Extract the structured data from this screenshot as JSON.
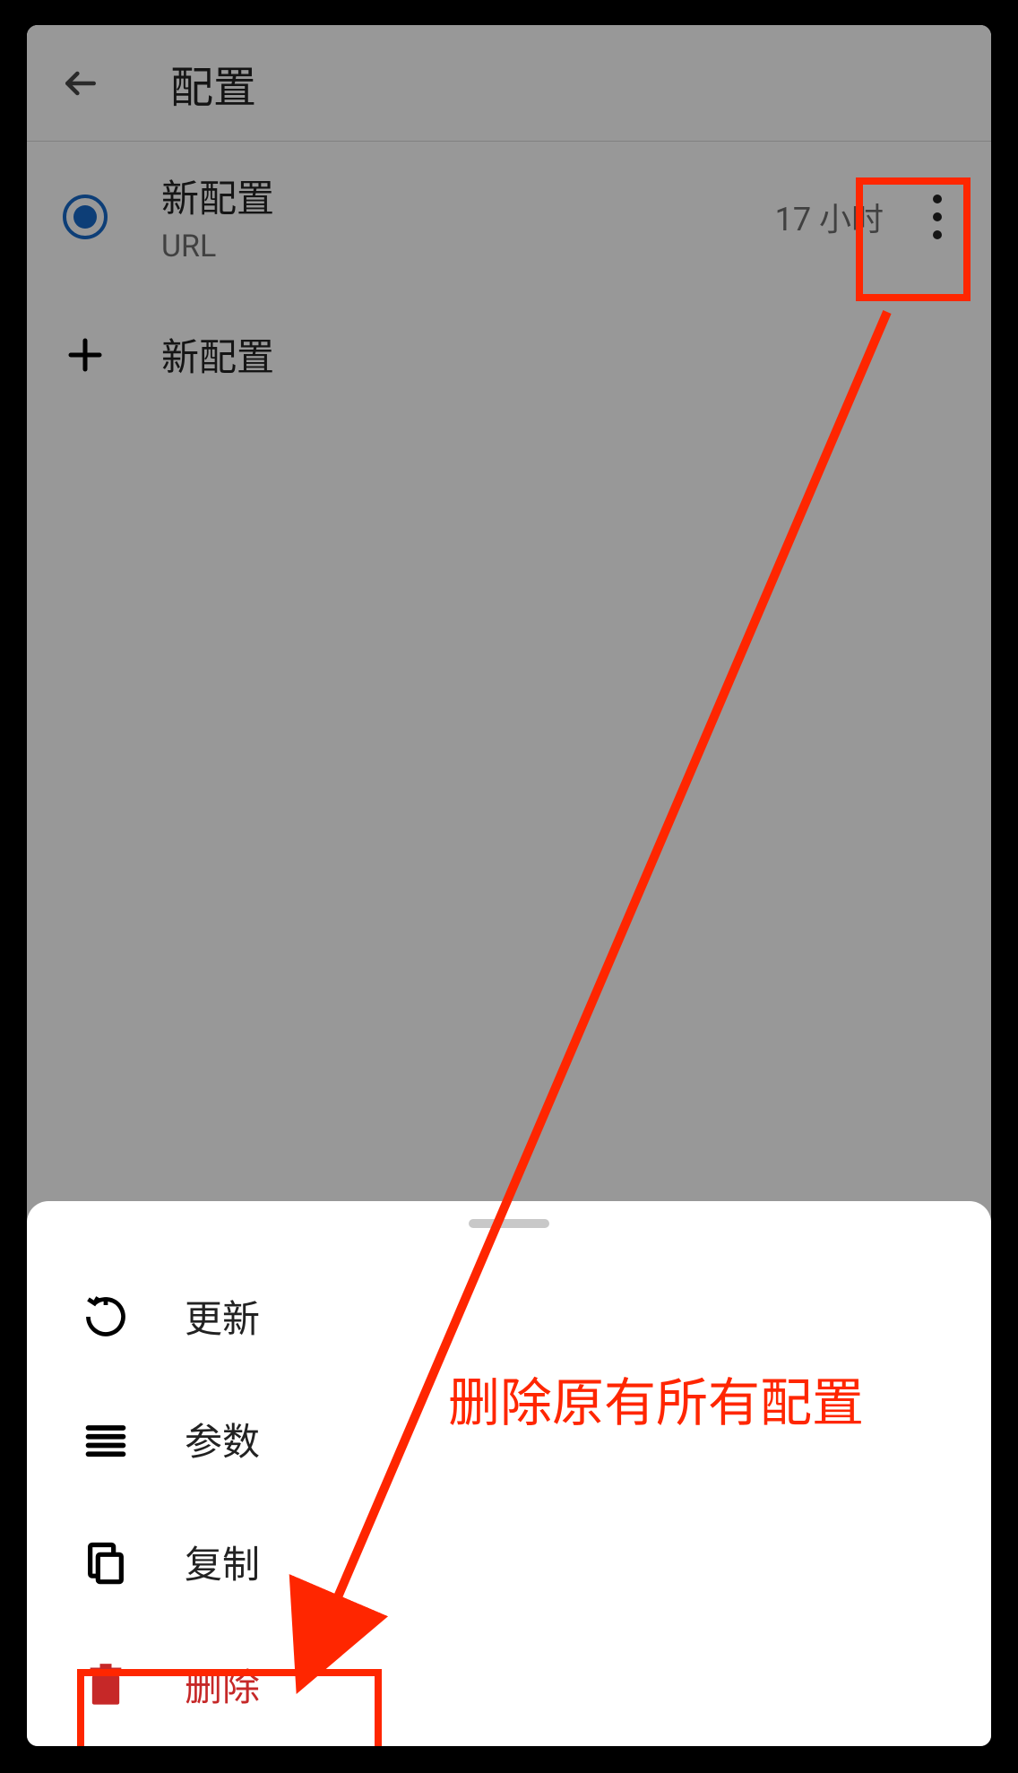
{
  "header": {
    "title": "配置"
  },
  "config_item": {
    "name": "新配置",
    "subtitle": "URL",
    "time": "17 小时"
  },
  "add_button": {
    "label": "新配置"
  },
  "sheet": {
    "update": "更新",
    "params": "参数",
    "copy": "复制",
    "delete": "删除"
  },
  "annotation": {
    "text": "删除原有所有配置"
  },
  "colors": {
    "accent": "#1565c0",
    "danger": "#c62828",
    "highlight": "#ff2600"
  }
}
